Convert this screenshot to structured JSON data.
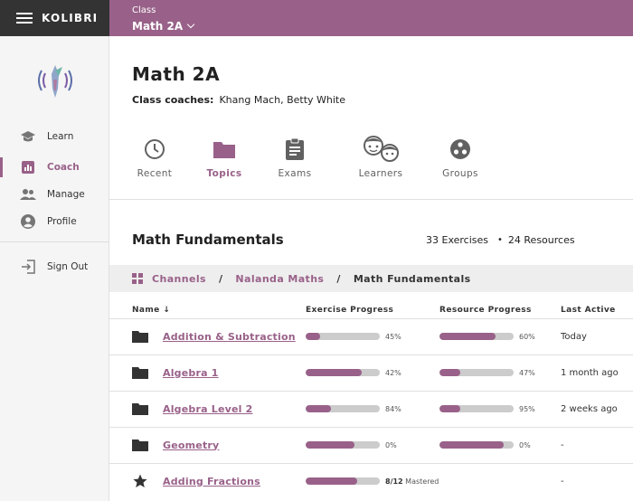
{
  "brand": "KOLIBRI",
  "appbar": {
    "label": "Class",
    "class_name": "Math 2A"
  },
  "sidebar": {
    "items": [
      {
        "label": "Learn",
        "icon": "learn-icon"
      },
      {
        "label": "Coach",
        "icon": "coach-icon",
        "active": true
      },
      {
        "label": "Manage",
        "icon": "manage-icon"
      },
      {
        "label": "Profile",
        "icon": "profile-icon"
      },
      {
        "label": "Sign Out",
        "icon": "sign-out-icon"
      }
    ]
  },
  "header": {
    "title": "Math 2A",
    "coaches_label": "Class coaches:",
    "coaches": "Khang Mach, Betty White"
  },
  "tabs": [
    {
      "label": "Recent",
      "icon": "clock-icon"
    },
    {
      "label": "Topics",
      "icon": "folder-icon",
      "active": true
    },
    {
      "label": "Exams",
      "icon": "clipboard-icon"
    },
    {
      "label": "Learners",
      "icon": "learners-icon"
    },
    {
      "label": "Groups",
      "icon": "groups-icon"
    }
  ],
  "section": {
    "title": "Math Fundamentals",
    "exercises": "33 Exercises",
    "resources": "24 Resources"
  },
  "breadcrumb": {
    "channels": "Channels",
    "sep": "/",
    "channel": "Nalanda Maths",
    "current": "Math Fundamentals"
  },
  "table": {
    "headers": {
      "name": "Name",
      "exercise_progress": "Exercise Progress",
      "resource_progress": "Resource Progress",
      "last_active": "Last Active"
    },
    "rows": [
      {
        "icon": "folder-icon",
        "name": "Addition & Subtraction",
        "ex_fill": 0.19,
        "ex_pct": "45%",
        "res_fill": 0.75,
        "res_pct": "60%",
        "last_active": "Today"
      },
      {
        "icon": "folder-icon",
        "name": "Algebra 1",
        "ex_fill": 0.75,
        "ex_pct": "42%",
        "res_fill": 0.28,
        "res_pct": "47%",
        "last_active": "1 month ago"
      },
      {
        "icon": "folder-icon",
        "name": "Algebra Level 2",
        "ex_fill": 0.34,
        "ex_pct": "84%",
        "res_fill": 0.28,
        "res_pct": "95%",
        "last_active": "2 weeks ago"
      },
      {
        "icon": "folder-icon",
        "name": "Geometry",
        "ex_fill": 0.66,
        "ex_pct": "0%",
        "res_fill": 0.86,
        "res_pct": "0%",
        "last_active": "-"
      },
      {
        "icon": "star-icon",
        "name": "Adding Fractions",
        "ex_fill": 0.7,
        "mastered_count": "8/12",
        "mastered_label": "Mastered",
        "last_active": "-"
      }
    ]
  },
  "colors": {
    "accent": "#996189",
    "brand_bar": "#333333"
  }
}
